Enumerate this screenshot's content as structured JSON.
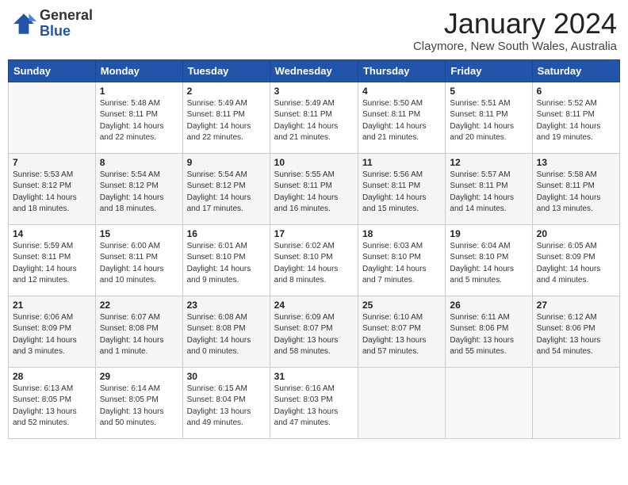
{
  "header": {
    "logo_general": "General",
    "logo_blue": "Blue",
    "month_title": "January 2024",
    "location": "Claymore, New South Wales, Australia"
  },
  "days_of_week": [
    "Sunday",
    "Monday",
    "Tuesday",
    "Wednesday",
    "Thursday",
    "Friday",
    "Saturday"
  ],
  "weeks": [
    [
      {
        "day": "",
        "info": ""
      },
      {
        "day": "1",
        "info": "Sunrise: 5:48 AM\nSunset: 8:11 PM\nDaylight: 14 hours\nand 22 minutes."
      },
      {
        "day": "2",
        "info": "Sunrise: 5:49 AM\nSunset: 8:11 PM\nDaylight: 14 hours\nand 22 minutes."
      },
      {
        "day": "3",
        "info": "Sunrise: 5:49 AM\nSunset: 8:11 PM\nDaylight: 14 hours\nand 21 minutes."
      },
      {
        "day": "4",
        "info": "Sunrise: 5:50 AM\nSunset: 8:11 PM\nDaylight: 14 hours\nand 21 minutes."
      },
      {
        "day": "5",
        "info": "Sunrise: 5:51 AM\nSunset: 8:11 PM\nDaylight: 14 hours\nand 20 minutes."
      },
      {
        "day": "6",
        "info": "Sunrise: 5:52 AM\nSunset: 8:11 PM\nDaylight: 14 hours\nand 19 minutes."
      }
    ],
    [
      {
        "day": "7",
        "info": "Sunrise: 5:53 AM\nSunset: 8:12 PM\nDaylight: 14 hours\nand 18 minutes."
      },
      {
        "day": "8",
        "info": "Sunrise: 5:54 AM\nSunset: 8:12 PM\nDaylight: 14 hours\nand 18 minutes."
      },
      {
        "day": "9",
        "info": "Sunrise: 5:54 AM\nSunset: 8:12 PM\nDaylight: 14 hours\nand 17 minutes."
      },
      {
        "day": "10",
        "info": "Sunrise: 5:55 AM\nSunset: 8:11 PM\nDaylight: 14 hours\nand 16 minutes."
      },
      {
        "day": "11",
        "info": "Sunrise: 5:56 AM\nSunset: 8:11 PM\nDaylight: 14 hours\nand 15 minutes."
      },
      {
        "day": "12",
        "info": "Sunrise: 5:57 AM\nSunset: 8:11 PM\nDaylight: 14 hours\nand 14 minutes."
      },
      {
        "day": "13",
        "info": "Sunrise: 5:58 AM\nSunset: 8:11 PM\nDaylight: 14 hours\nand 13 minutes."
      }
    ],
    [
      {
        "day": "14",
        "info": "Sunrise: 5:59 AM\nSunset: 8:11 PM\nDaylight: 14 hours\nand 12 minutes."
      },
      {
        "day": "15",
        "info": "Sunrise: 6:00 AM\nSunset: 8:11 PM\nDaylight: 14 hours\nand 10 minutes."
      },
      {
        "day": "16",
        "info": "Sunrise: 6:01 AM\nSunset: 8:10 PM\nDaylight: 14 hours\nand 9 minutes."
      },
      {
        "day": "17",
        "info": "Sunrise: 6:02 AM\nSunset: 8:10 PM\nDaylight: 14 hours\nand 8 minutes."
      },
      {
        "day": "18",
        "info": "Sunrise: 6:03 AM\nSunset: 8:10 PM\nDaylight: 14 hours\nand 7 minutes."
      },
      {
        "day": "19",
        "info": "Sunrise: 6:04 AM\nSunset: 8:10 PM\nDaylight: 14 hours\nand 5 minutes."
      },
      {
        "day": "20",
        "info": "Sunrise: 6:05 AM\nSunset: 8:09 PM\nDaylight: 14 hours\nand 4 minutes."
      }
    ],
    [
      {
        "day": "21",
        "info": "Sunrise: 6:06 AM\nSunset: 8:09 PM\nDaylight: 14 hours\nand 3 minutes."
      },
      {
        "day": "22",
        "info": "Sunrise: 6:07 AM\nSunset: 8:08 PM\nDaylight: 14 hours\nand 1 minute."
      },
      {
        "day": "23",
        "info": "Sunrise: 6:08 AM\nSunset: 8:08 PM\nDaylight: 14 hours\nand 0 minutes."
      },
      {
        "day": "24",
        "info": "Sunrise: 6:09 AM\nSunset: 8:07 PM\nDaylight: 13 hours\nand 58 minutes."
      },
      {
        "day": "25",
        "info": "Sunrise: 6:10 AM\nSunset: 8:07 PM\nDaylight: 13 hours\nand 57 minutes."
      },
      {
        "day": "26",
        "info": "Sunrise: 6:11 AM\nSunset: 8:06 PM\nDaylight: 13 hours\nand 55 minutes."
      },
      {
        "day": "27",
        "info": "Sunrise: 6:12 AM\nSunset: 8:06 PM\nDaylight: 13 hours\nand 54 minutes."
      }
    ],
    [
      {
        "day": "28",
        "info": "Sunrise: 6:13 AM\nSunset: 8:05 PM\nDaylight: 13 hours\nand 52 minutes."
      },
      {
        "day": "29",
        "info": "Sunrise: 6:14 AM\nSunset: 8:05 PM\nDaylight: 13 hours\nand 50 minutes."
      },
      {
        "day": "30",
        "info": "Sunrise: 6:15 AM\nSunset: 8:04 PM\nDaylight: 13 hours\nand 49 minutes."
      },
      {
        "day": "31",
        "info": "Sunrise: 6:16 AM\nSunset: 8:03 PM\nDaylight: 13 hours\nand 47 minutes."
      },
      {
        "day": "",
        "info": ""
      },
      {
        "day": "",
        "info": ""
      },
      {
        "day": "",
        "info": ""
      }
    ]
  ]
}
